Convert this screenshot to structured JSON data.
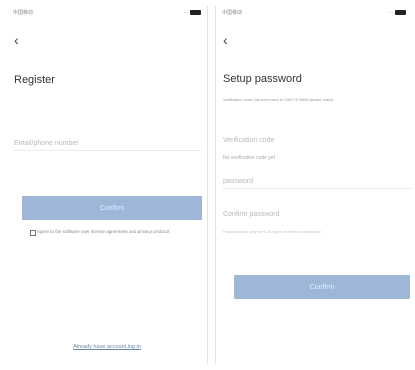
{
  "left": {
    "status_time": "中国移动",
    "status_right": "...",
    "title": "Register",
    "email_placeholder": "Email/phone number",
    "confirm_label": "Confirm",
    "agreement_text": "Agree to the software user license agreement and privacy protocol",
    "link_text": "Already have account,log in"
  },
  "right": {
    "status_time": "中国移动",
    "status_right": "...",
    "title": "Setup password",
    "subtitle": "Verification code has been sent to 13877478999,please check",
    "verification_label": "Verification code",
    "verification_hint": "No verification code yet",
    "password_label": "password",
    "confirm_password_label": "Confirm password",
    "confirm_password_hint": "Password can only be 6-20 digits or letters combination",
    "confirm_label": "Confirm"
  }
}
